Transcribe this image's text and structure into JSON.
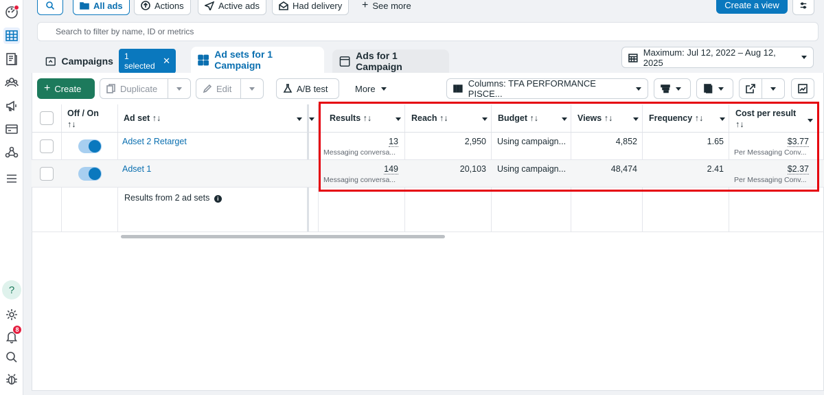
{
  "toolbar_top": {
    "all_ads": "All ads",
    "actions": "Actions",
    "active_ads": "Active ads",
    "had_delivery": "Had delivery",
    "see_more": "See more",
    "create_view": "Create a view"
  },
  "search": {
    "placeholder": "Search to filter by name, ID or metrics"
  },
  "tabs": {
    "campaigns": "Campaigns",
    "selected_chip": "1 selected",
    "adsets": "Ad sets for 1 Campaign",
    "ads": "Ads for 1 Campaign"
  },
  "date_range": "Maximum: Jul 12, 2022 – Aug 12, 2025",
  "actions": {
    "create": "Create",
    "duplicate": "Duplicate",
    "edit": "Edit",
    "ab_test": "A/B test",
    "more": "More",
    "columns": "Columns: TFA PERFORMANCE PISCE..."
  },
  "table": {
    "headers": {
      "offon": "Off / On",
      "adset": "Ad set",
      "results": "Results",
      "reach": "Reach",
      "budget": "Budget",
      "views": "Views",
      "frequency": "Frequency",
      "cost": "Cost per result"
    },
    "sort_glyph": "↑↓",
    "rows": [
      {
        "name": "Adset 2 Retarget",
        "results": "13",
        "results_sub": "Messaging conversa...",
        "reach": "2,950",
        "budget": "Using campaign...",
        "views": "4,852",
        "frequency": "1.65",
        "cost": "$3.77",
        "cost_sub": "Per Messaging Conv..."
      },
      {
        "name": "Adset 1",
        "results": "149",
        "results_sub": "Messaging conversa...",
        "reach": "20,103",
        "budget": "Using campaign...",
        "views": "48,474",
        "frequency": "2.41",
        "cost": "$2.37",
        "cost_sub": "Per Messaging Conv..."
      }
    ],
    "footer": "Results from 2 ad sets"
  },
  "nav": {
    "notification_count": "8",
    "help": "?"
  },
  "colors": {
    "accent": "#0a78be",
    "create_green": "#1d7a5c",
    "highlight_red": "#e5000d"
  }
}
